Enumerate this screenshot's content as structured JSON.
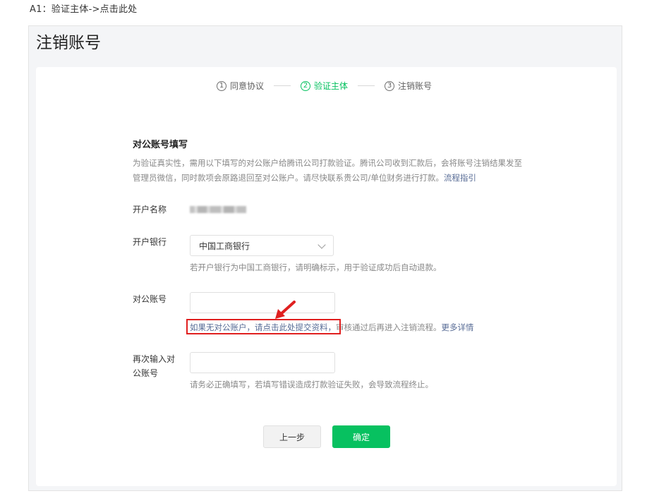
{
  "note": "A1：验证主体->点击此处",
  "page": {
    "title": "注销账号"
  },
  "stepper": {
    "steps": [
      {
        "num": "1",
        "label": "同意协议"
      },
      {
        "num": "2",
        "label": "验证主体"
      },
      {
        "num": "3",
        "label": "注销账号"
      }
    ]
  },
  "section": {
    "title": "对公账号填写",
    "desc": "为验证真实性，需用以下填写的对公账户给腾讯公司打款验证。腾讯公司收到汇款后，会将账号注销结果发至管理员微信，同时款项会原路退回至对公账户。请尽快联系贵公司/单位财务进行打款。",
    "desc_link": "流程指引"
  },
  "fields": {
    "account_name_label": "开户名称",
    "bank_label": "开户银行",
    "bank_value": "中国工商银行",
    "bank_hint": "若开户银行为中国工商银行，请明确标示，用于验证成功后自动退款。",
    "account_label": "对公账号",
    "account_hint_a": "如果无对公账户，请点击此处提交资料，",
    "account_hint_b": "审核通过后再进入注销流程。",
    "account_hint_link": "更多详情",
    "confirm_label_line1": "再次输入对",
    "confirm_label_line2": "公账号",
    "confirm_hint": "请务必正确填写，若填写错误造成打款验证失败，会导致流程终止。"
  },
  "buttons": {
    "prev": "上一步",
    "ok": "确定"
  },
  "colors": {
    "accent": "#07c160",
    "link": "#576b95",
    "annotation": "#e02020"
  }
}
